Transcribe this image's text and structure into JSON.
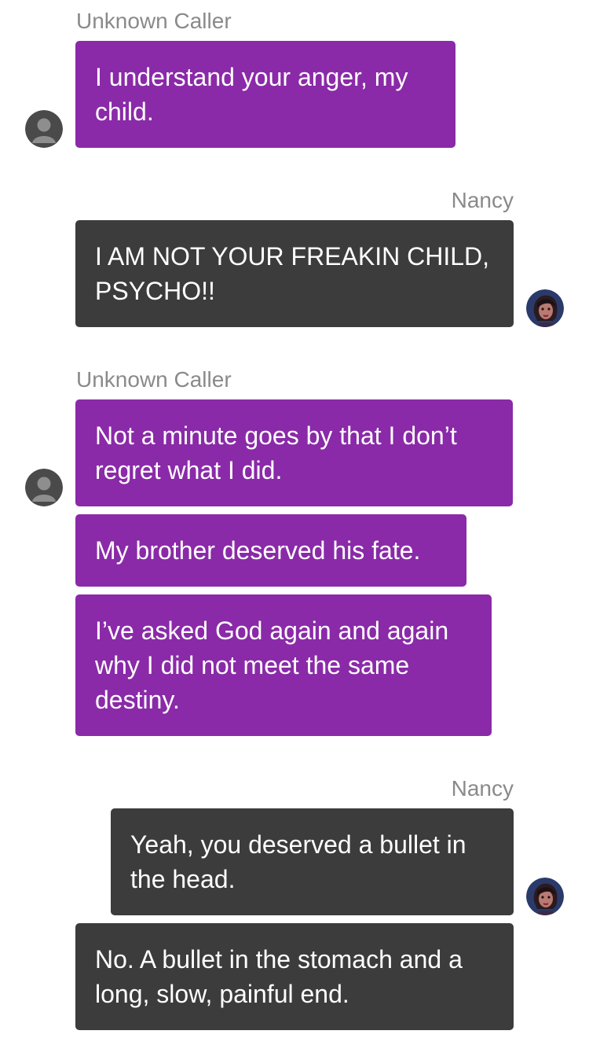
{
  "messages": [
    {
      "sender": "Unknown Caller",
      "bubbles": [
        "I understand your anger, my child."
      ]
    },
    {
      "sender": "Nancy",
      "bubbles": [
        "I AM NOT YOUR FREAKIN CHILD, PSYCHO!!"
      ]
    },
    {
      "sender": "Unknown Caller",
      "bubbles": [
        "Not a minute goes by that I don’t regret what I did.",
        "My brother deserved his fate.",
        "I’ve asked God again and again why I did not meet the same destiny."
      ]
    },
    {
      "sender": "Nancy",
      "bubbles": [
        "Yeah, you deserved a bullet in the head.",
        "No. A bullet in the stomach and a long, slow, painful end."
      ]
    }
  ],
  "colors": {
    "caller_bubble": "#8a2aa8",
    "user_bubble": "#3c3c3c",
    "sender_label": "#8a8a8a",
    "bubble_text": "#ffffff"
  },
  "icons": {
    "caller_avatar": "default-user-silhouette-icon",
    "user_avatar": "nancy-portrait-icon"
  }
}
